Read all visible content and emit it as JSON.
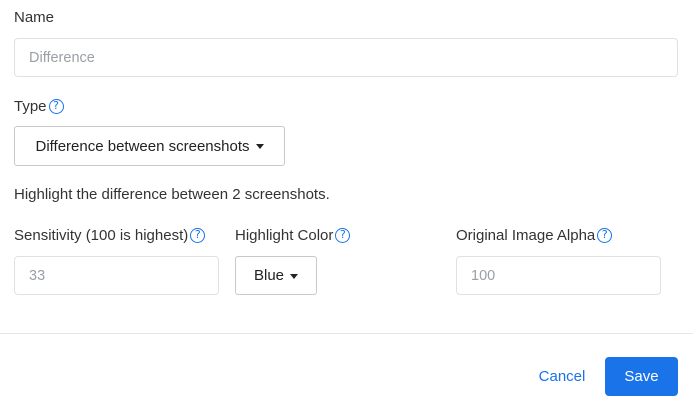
{
  "form": {
    "name": {
      "label": "Name",
      "value": "",
      "placeholder": "Difference"
    },
    "type": {
      "label": "Type",
      "help_icon": "?",
      "selected": "Difference between screenshots"
    },
    "description": "Highlight the difference between 2 screenshots.",
    "sensitivity": {
      "label": "Sensitivity (100 is highest)",
      "help_icon": "?",
      "value": "",
      "placeholder": "33"
    },
    "highlight_color": {
      "label": "Highlight Color",
      "help_icon": "?",
      "selected": "Blue"
    },
    "original_alpha": {
      "label": "Original Image Alpha",
      "help_icon": "?",
      "value": "",
      "placeholder": "100"
    }
  },
  "footer": {
    "cancel_label": "Cancel",
    "save_label": "Save"
  },
  "colors": {
    "accent": "#1a73e8",
    "border": "#dfe1e5",
    "text": "#333333",
    "placeholder": "#9aa0a6"
  },
  "icons": {
    "help": "question-circle-icon",
    "caret": "caret-down-icon"
  }
}
